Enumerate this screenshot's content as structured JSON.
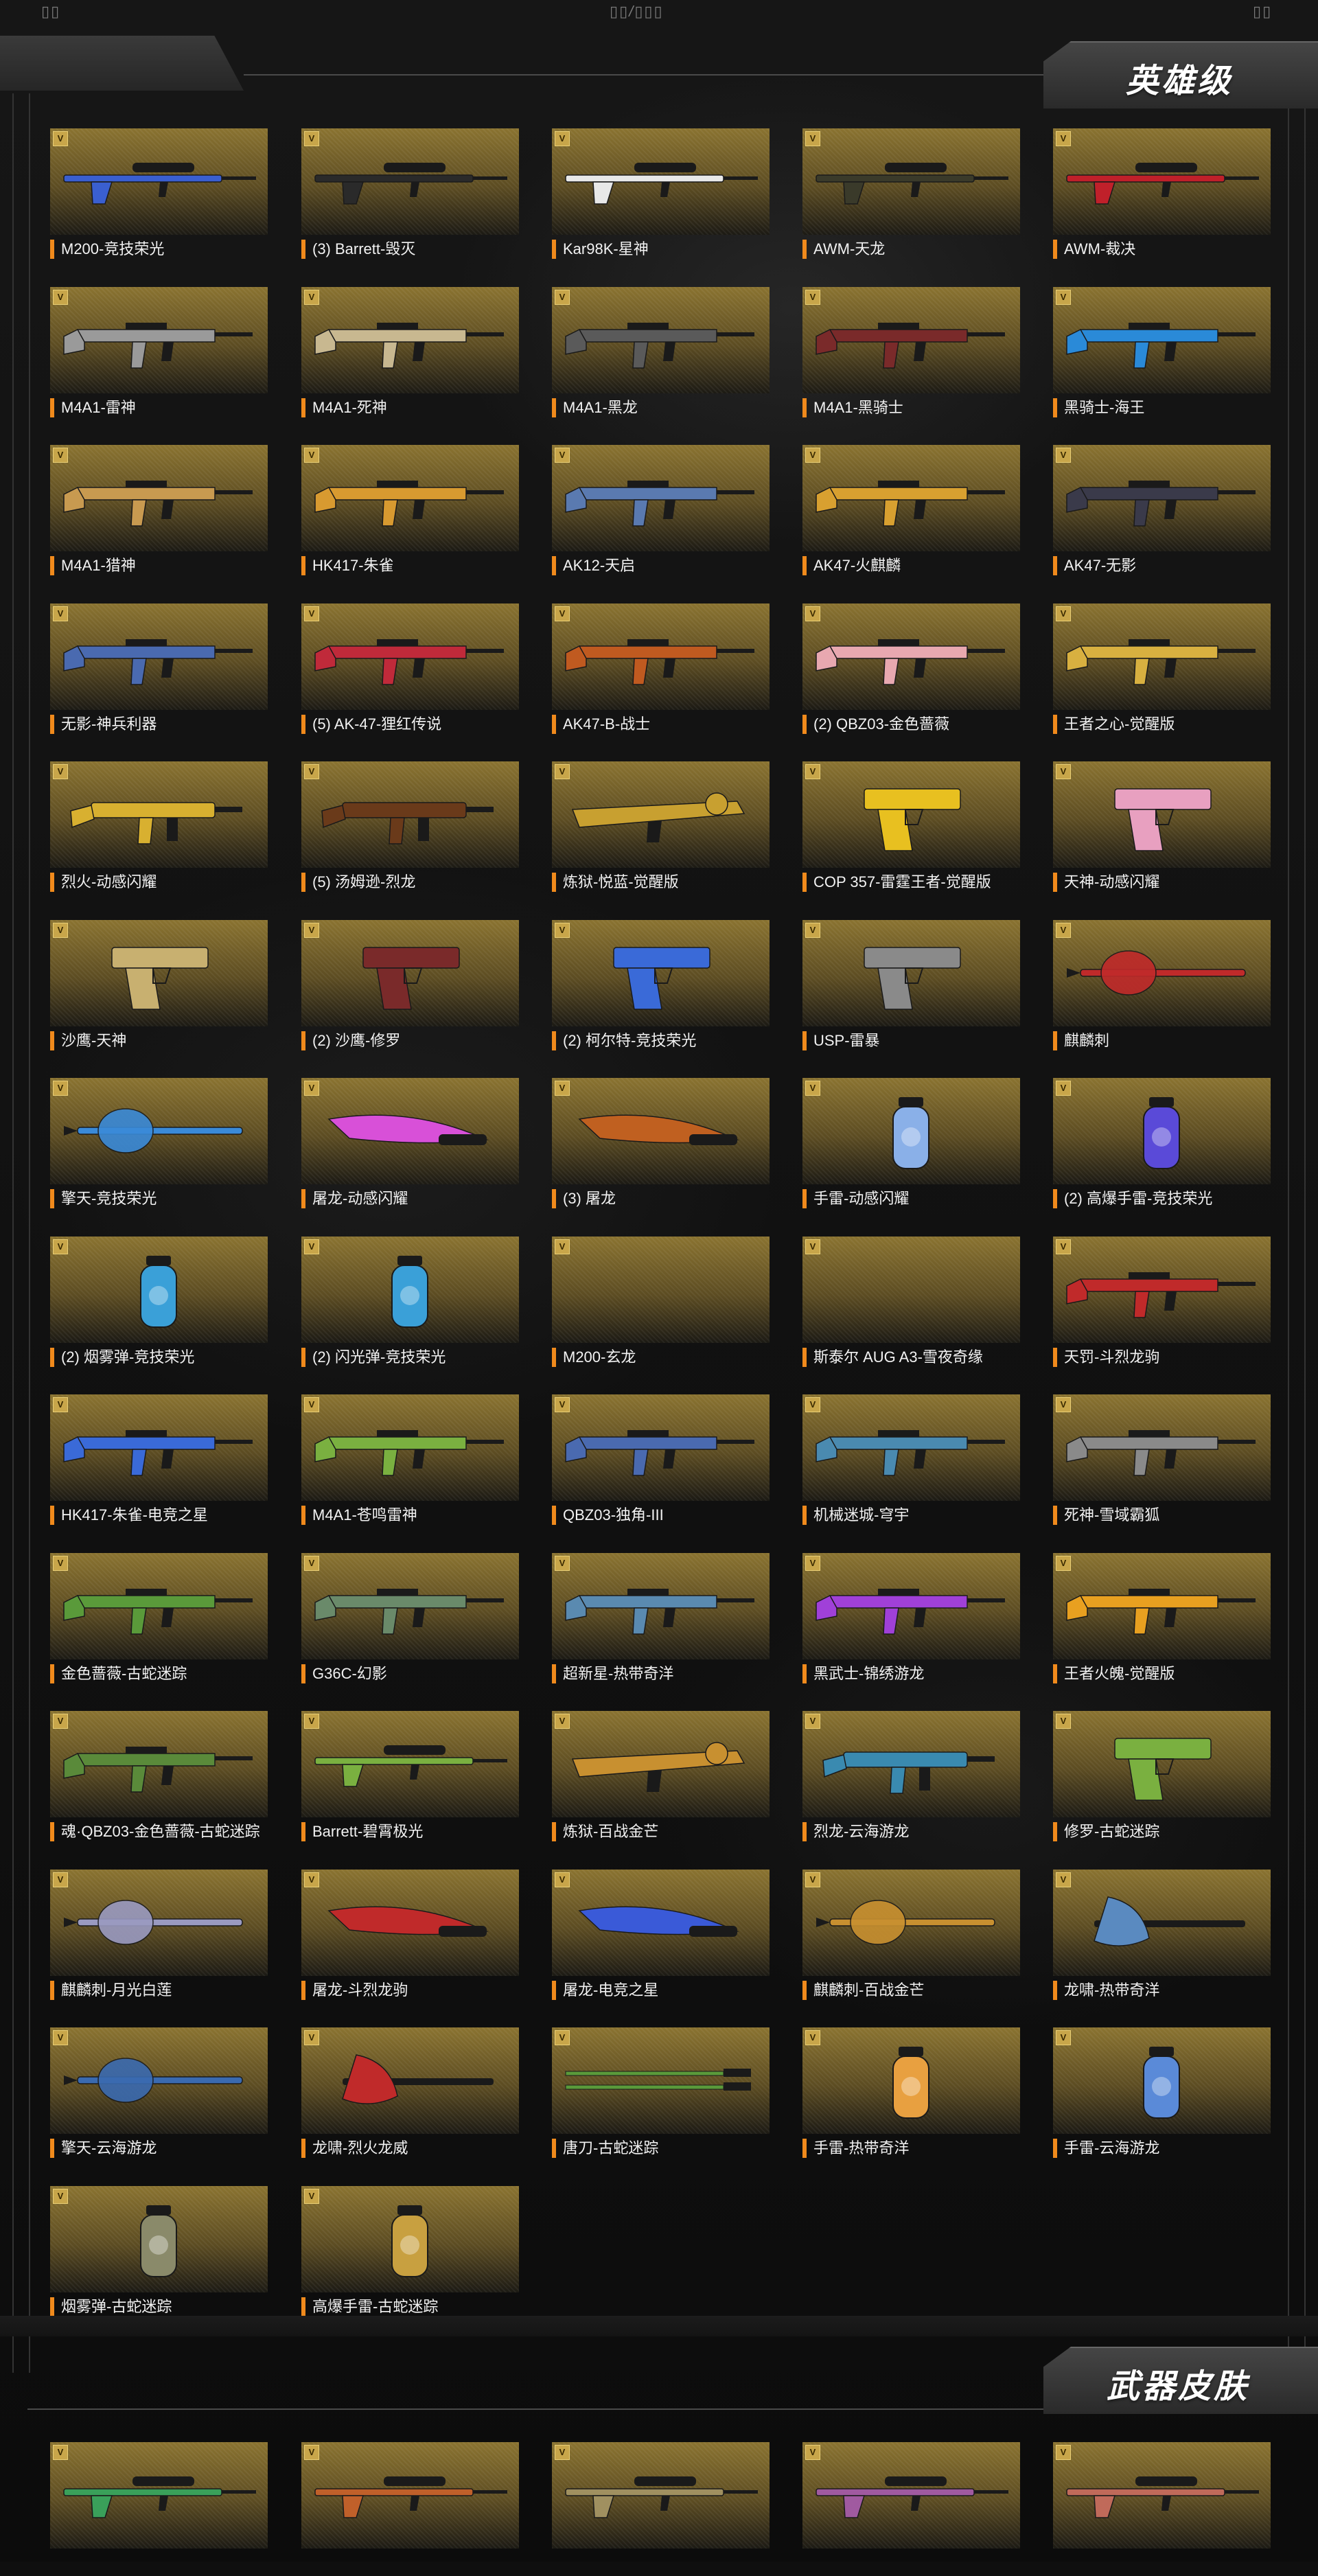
{
  "top_bar": {
    "left_glyphs": "▯▯",
    "center_glyphs": "▯▯/▯▯▯",
    "right_glyphs": "▯▯"
  },
  "sections": [
    {
      "title": "英雄级"
    },
    {
      "title": "武器皮肤"
    }
  ],
  "tier_badge": "V",
  "colors": {
    "accent": "#f08a1c",
    "card_gold": "#8a7330",
    "background": "#0f0f0f"
  },
  "hero_items": [
    {
      "label": "M200-竞技荣光",
      "icon": "sniper-rifle-icon",
      "art": "sniper",
      "color": "#3a5fd0"
    },
    {
      "label": "(3) Barrett-毁灭",
      "icon": "sniper-rifle-icon",
      "art": "sniper",
      "color": "#2a2a2a"
    },
    {
      "label": "Kar98K-星神",
      "icon": "sniper-rifle-icon",
      "art": "sniper",
      "color": "#e8e8e8"
    },
    {
      "label": "AWM-天龙",
      "icon": "sniper-rifle-icon",
      "art": "sniper",
      "color": "#3a3a2a"
    },
    {
      "label": "AWM-裁决",
      "icon": "sniper-rifle-icon",
      "art": "sniper",
      "color": "#c0202a"
    },
    {
      "label": "M4A1-雷神",
      "icon": "assault-rifle-icon",
      "art": "rifle",
      "color": "#9a9a9a"
    },
    {
      "label": "M4A1-死神",
      "icon": "assault-rifle-icon",
      "art": "rifle",
      "color": "#c8b890"
    },
    {
      "label": "M4A1-黑龙",
      "icon": "assault-rifle-icon",
      "art": "rifle",
      "color": "#5a5a5a"
    },
    {
      "label": "M4A1-黑骑士",
      "icon": "assault-rifle-icon",
      "art": "rifle",
      "color": "#7a2a2a"
    },
    {
      "label": "黑骑士-海王",
      "icon": "assault-rifle-icon",
      "art": "rifle",
      "color": "#2a8ad8"
    },
    {
      "label": "M4A1-猎神",
      "icon": "assault-rifle-icon",
      "art": "rifle",
      "color": "#c89a50"
    },
    {
      "label": "HK417-朱雀",
      "icon": "assault-rifle-icon",
      "art": "rifle",
      "color": "#d89a30"
    },
    {
      "label": "AK12-天启",
      "icon": "assault-rifle-icon",
      "art": "rifle",
      "color": "#5a7ab0"
    },
    {
      "label": "AK47-火麒麟",
      "icon": "assault-rifle-icon",
      "art": "rifle",
      "color": "#d8a030"
    },
    {
      "label": "AK47-无影",
      "icon": "assault-rifle-icon",
      "art": "rifle",
      "color": "#3a3a4a"
    },
    {
      "label": "无影-神兵利器",
      "icon": "assault-rifle-icon",
      "art": "rifle",
      "color": "#4a6ab0"
    },
    {
      "label": "(5) AK-47-狸红传说",
      "icon": "assault-rifle-icon",
      "art": "rifle",
      "color": "#c02a3a"
    },
    {
      "label": "AK47-B-战士",
      "icon": "assault-rifle-icon",
      "art": "rifle",
      "color": "#c05a20"
    },
    {
      "label": "(2) QBZ03-金色蔷薇",
      "icon": "assault-rifle-icon",
      "art": "rifle",
      "color": "#e8a8b0"
    },
    {
      "label": "王者之心-觉醒版",
      "icon": "assault-rifle-icon",
      "art": "rifle",
      "color": "#d8b040"
    },
    {
      "label": "烈火-动感闪耀",
      "icon": "smg-icon",
      "art": "smg",
      "color": "#d8b030"
    },
    {
      "label": "(5) 汤姆逊-烈龙",
      "icon": "smg-icon",
      "art": "smg",
      "color": "#6a3a1a"
    },
    {
      "label": "炼狱-悦蓝-觉醒版",
      "icon": "heavy-gun-icon",
      "art": "heavy",
      "color": "#c8a030"
    },
    {
      "label": "COP 357-雷霆王者-觉醒版",
      "icon": "pistol-icon",
      "art": "pistol",
      "color": "#e8c020"
    },
    {
      "label": "天神-动感闪耀",
      "icon": "pistol-icon",
      "art": "pistol",
      "color": "#e8a0c0"
    },
    {
      "label": "沙鹰-天神",
      "icon": "pistol-icon",
      "art": "pistol",
      "color": "#c8b070"
    },
    {
      "label": "(2) 沙鹰-修罗",
      "icon": "pistol-icon",
      "art": "pistol",
      "color": "#7a2a2a"
    },
    {
      "label": "(2) 柯尔特-竞技荣光",
      "icon": "pistol-icon",
      "art": "pistol",
      "color": "#3a6ad8"
    },
    {
      "label": "USP-雷暴",
      "icon": "pistol-icon",
      "art": "pistol",
      "color": "#8a8a8a"
    },
    {
      "label": "麒麟刺",
      "icon": "melee-icon",
      "art": "melee",
      "color": "#c02a2a"
    },
    {
      "label": "擎天-竞技荣光",
      "icon": "melee-icon",
      "art": "melee",
      "color": "#3a8ad8"
    },
    {
      "label": "屠龙-动感闪耀",
      "icon": "knife-icon",
      "art": "knife",
      "color": "#d850d8"
    },
    {
      "label": "(3) 屠龙",
      "icon": "knife-icon",
      "art": "knife",
      "color": "#c06020"
    },
    {
      "label": "手雷-动感闪耀",
      "icon": "grenade-icon",
      "art": "grenade",
      "color": "#8ab0e8"
    },
    {
      "label": "(2) 高爆手雷-竞技荣光",
      "icon": "grenade-icon",
      "art": "grenade",
      "color": "#5a4ad8"
    },
    {
      "label": "(2) 烟雾弹-竞技荣光",
      "icon": "grenade-icon",
      "art": "grenade",
      "color": "#3aa0d8"
    },
    {
      "label": "(2) 闪光弹-竞技荣光",
      "icon": "grenade-icon",
      "art": "grenade",
      "color": "#3aa0d8"
    },
    {
      "label": "M200-玄龙",
      "icon": "sniper-rifle-icon",
      "art": "none",
      "color": "#000000"
    },
    {
      "label": "斯泰尔 AUG A3-雪夜奇缘",
      "icon": "assault-rifle-icon",
      "art": "none",
      "color": "#000000"
    },
    {
      "label": "天罚-斗烈龙驹",
      "icon": "assault-rifle-icon",
      "art": "rifle",
      "color": "#c02a2a"
    },
    {
      "label": "HK417-朱雀-电竞之星",
      "icon": "assault-rifle-icon",
      "art": "rifle",
      "color": "#3a6ad8"
    },
    {
      "label": "M4A1-苍鸣雷神",
      "icon": "assault-rifle-icon",
      "art": "rifle",
      "color": "#7ab040"
    },
    {
      "label": "QBZ03-独角-III",
      "icon": "assault-rifle-icon",
      "art": "rifle",
      "color": "#4a6ab0"
    },
    {
      "label": "机械迷城-穹宇",
      "icon": "assault-rifle-icon",
      "art": "rifle",
      "color": "#4a8ab0"
    },
    {
      "label": "死神-雪域霸狐",
      "icon": "assault-rifle-icon",
      "art": "rifle",
      "color": "#8a8a8a"
    },
    {
      "label": "金色蔷薇-古蛇迷踪",
      "icon": "assault-rifle-icon",
      "art": "rifle",
      "color": "#5a9a3a"
    },
    {
      "label": "G36C-幻影",
      "icon": "assault-rifle-icon",
      "art": "rifle",
      "color": "#6a8a6a"
    },
    {
      "label": "超新星-热带奇洋",
      "icon": "assault-rifle-icon",
      "art": "rifle",
      "color": "#5a8ab0"
    },
    {
      "label": "黑武士-锦绣游龙",
      "icon": "assault-rifle-icon",
      "art": "rifle",
      "color": "#a040d8"
    },
    {
      "label": "王者火魄-觉醒版",
      "icon": "assault-rifle-icon",
      "art": "rifle",
      "color": "#e8a020"
    },
    {
      "label": "魂·QBZ03-金色蔷薇-古蛇迷踪",
      "icon": "assault-rifle-icon",
      "art": "rifle",
      "color": "#5a8a3a"
    },
    {
      "label": "Barrett-碧霄极光",
      "icon": "sniper-rifle-icon",
      "art": "sniper",
      "color": "#7ab040"
    },
    {
      "label": "炼狱-百战金芒",
      "icon": "heavy-gun-icon",
      "art": "heavy",
      "color": "#c89030"
    },
    {
      "label": "烈龙-云海游龙",
      "icon": "smg-icon",
      "art": "smg",
      "color": "#3a8ab0"
    },
    {
      "label": "修罗-古蛇迷踪",
      "icon": "pistol-icon",
      "art": "pistol",
      "color": "#7ab040"
    },
    {
      "label": "麒麟刺-月光白莲",
      "icon": "melee-icon",
      "art": "melee",
      "color": "#9a9ac0"
    },
    {
      "label": "屠龙-斗烈龙驹",
      "icon": "knife-icon",
      "art": "knife",
      "color": "#c02a2a"
    },
    {
      "label": "屠龙-电竞之星",
      "icon": "knife-icon",
      "art": "knife",
      "color": "#3a5ad8"
    },
    {
      "label": "麒麟刺-百战金芒",
      "icon": "melee-icon",
      "art": "melee",
      "color": "#c89030"
    },
    {
      "label": "龙啸-热带奇洋",
      "icon": "melee-icon",
      "art": "axe",
      "color": "#5a8ac0"
    },
    {
      "label": "擎天-云海游龙",
      "icon": "melee-icon",
      "art": "melee",
      "color": "#3a6ab0"
    },
    {
      "label": "龙啸-烈火龙威",
      "icon": "melee-icon",
      "art": "axe",
      "color": "#c02a2a"
    },
    {
      "label": "唐刀-古蛇迷踪",
      "icon": "sword-icon",
      "art": "sword",
      "color": "#5a9a3a"
    },
    {
      "label": "手雷-热带奇洋",
      "icon": "grenade-icon",
      "art": "grenade",
      "color": "#e8a040"
    },
    {
      "label": "手雷-云海游龙",
      "icon": "grenade-icon",
      "art": "grenade",
      "color": "#5a8ad8"
    },
    {
      "label": "烟雾弹-古蛇迷踪",
      "icon": "grenade-icon",
      "art": "grenade",
      "color": "#8a8a6a"
    },
    {
      "label": "高爆手雷-古蛇迷踪",
      "icon": "grenade-icon",
      "art": "grenade",
      "color": "#c8a040"
    }
  ],
  "skin_items": [
    {
      "label": "",
      "icon": "sniper-rifle-icon",
      "art": "sniper",
      "color": "#3aa05a"
    },
    {
      "label": "",
      "icon": "sniper-rifle-icon",
      "art": "sniper",
      "color": "#c0602a"
    },
    {
      "label": "",
      "icon": "sniper-rifle-icon",
      "art": "sniper",
      "color": "#a09060"
    },
    {
      "label": "",
      "icon": "sniper-rifle-icon",
      "art": "sniper",
      "color": "#a05aa0"
    },
    {
      "label": "",
      "icon": "sniper-rifle-icon",
      "art": "sniper",
      "color": "#c06a5a"
    }
  ]
}
